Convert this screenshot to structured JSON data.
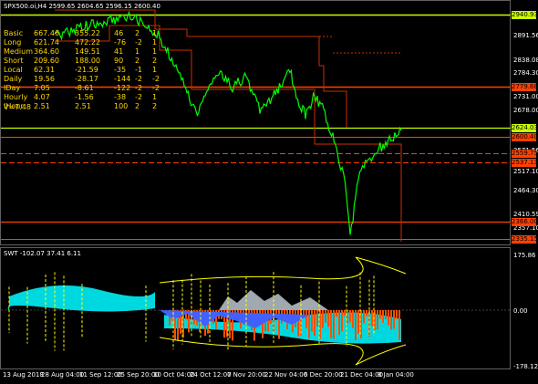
{
  "main_chart": {
    "title": "SPX500.oi,H4  2599.65 2604.65 2596.15 2600.40",
    "colors": {
      "background": "#000000",
      "candle_line": "#00ff00",
      "level_yellow": "#c8ff00",
      "level_red": "#ff4000",
      "step_red": "#c83000",
      "stats_text": "#ffd700"
    },
    "stats_rows": [
      {
        "name": "Basic",
        "v1": "667.46",
        "v2": "355.22",
        "v3": "46",
        "v4": "2",
        "v5": "1"
      },
      {
        "name": "Long",
        "v1": "621.74",
        "v2": "472.22",
        "v3": "-76",
        "v4": "-2",
        "v5": "1"
      },
      {
        "name": "Medium",
        "v1": "364.60",
        "v2": "149.51",
        "v3": "41",
        "v4": "1",
        "v5": "1"
      },
      {
        "name": "Short",
        "v1": "209.60",
        "v2": "188.00",
        "v3": "90",
        "v4": "2",
        "v5": "2"
      },
      {
        "name": "Local",
        "v1": "62.31",
        "v2": "-21.59",
        "v3": "-35",
        "v4": "-1",
        "v5": "1"
      },
      {
        "name": "Daily",
        "v1": "19.56",
        "v2": "-28.17",
        "v3": "-144",
        "v4": "-2",
        "v5": "-2"
      },
      {
        "name": "IDay",
        "v1": "7.05",
        "v2": "-8.61",
        "v3": "-122",
        "v4": "-2",
        "v5": "-2"
      },
      {
        "name": "Hourly",
        "v1": "4.07",
        "v2": "-1.56",
        "v3": "-38",
        "v4": "-2",
        "v5": "1"
      },
      {
        "name": "IHour",
        "v1": "2.51",
        "v2": "2.51",
        "v3": "100",
        "v4": "2",
        "v5": "2"
      }
    ],
    "volatility_label": "V=7.48",
    "price_axis": [
      "2891.56",
      "2838.08",
      "2784.30",
      "2731.00",
      "2678.00",
      "2571.56",
      "2517.10",
      "2464.30",
      "2410.59",
      "2357.10"
    ],
    "price_tags": [
      {
        "text": "2940.93",
        "bg": "#c8ff00"
      },
      {
        "text": "2779.68",
        "bg": "#ff4000"
      },
      {
        "text": "2624.03",
        "bg": "#c8ff00"
      },
      {
        "text": "2600.40",
        "bg": "#ff4000"
      },
      {
        "text": "2559.75",
        "bg": "#ff4000"
      },
      {
        "text": "2537.13",
        "bg": "#ff4000"
      },
      {
        "text": "2366.00",
        "bg": "#ff4000"
      },
      {
        "text": "2335.15",
        "bg": "#ff4000"
      }
    ]
  },
  "oscillator": {
    "title": "SWT -102.07 37.41 6.11",
    "axis": [
      "175.86",
      "0.00",
      "-178.12"
    ],
    "colors": {
      "cyan": "#00d8e0",
      "orange": "#ff5000",
      "yellow": "#ffff00",
      "blue": "#4060ff",
      "gray": "#a0a8b0"
    }
  },
  "time_axis": [
    "13 Aug 2018",
    "28 Aug 04:00",
    "11 Sep 12:00",
    "25 Sep 20:00",
    "10 Oct 04:00",
    "24 Oct 12:00",
    "7 Nov 20:00",
    "22 Nov 04:00",
    "6 Dec 20:00",
    "21 Dec 04:00",
    "8 Jan 04:00"
  ]
}
